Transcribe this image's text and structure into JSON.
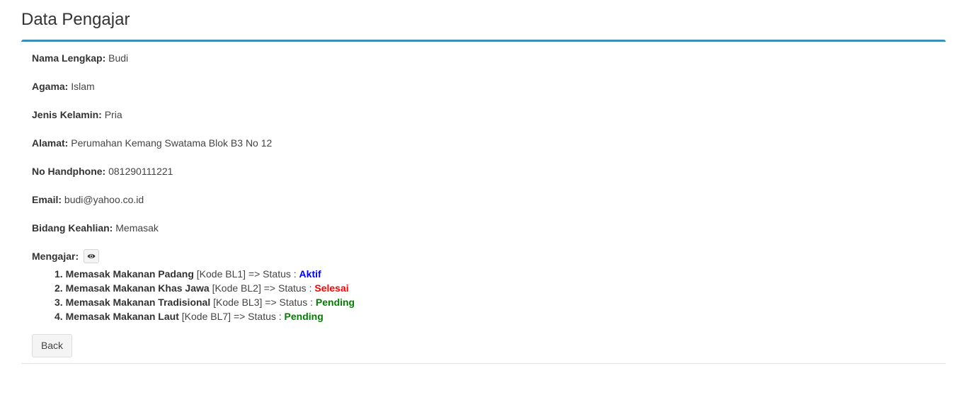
{
  "header": {
    "title": "Data Pengajar"
  },
  "fields": [
    {
      "label": "Nama Lengkap:",
      "value": "Budi"
    },
    {
      "label": "Agama:",
      "value": "Islam"
    },
    {
      "label": "Jenis Kelamin:",
      "value": "Pria"
    },
    {
      "label": "Alamat:",
      "value": "Perumahan Kemang Swatama Blok B3 No 12"
    },
    {
      "label": "No Handphone:",
      "value": "081290111221"
    },
    {
      "label": "Email:",
      "value": "budi@yahoo.co.id"
    },
    {
      "label": "Bidang Keahlian:",
      "value": "Memasak"
    }
  ],
  "teaching": {
    "label": "Mengajar:",
    "toggle_icon": "eye-icon",
    "items": [
      {
        "num": "1.",
        "course": "Memasak Makanan Padang",
        "code": "[Kode BL1]",
        "arrow": "=> Status :",
        "status": "Aktif",
        "status_color": "#0000ff"
      },
      {
        "num": "2.",
        "course": "Memasak Makanan Khas Jawa",
        "code": "[Kode BL2]",
        "arrow": "=> Status :",
        "status": "Selesai",
        "status_color": "#ff0000"
      },
      {
        "num": "3.",
        "course": "Memasak Makanan Tradisional",
        "code": "[Kode BL3]",
        "arrow": "=> Status :",
        "status": "Pending",
        "status_color": "#008000"
      },
      {
        "num": "4.",
        "course": "Memasak Makanan Laut",
        "code": "[Kode BL7]",
        "arrow": "=> Status :",
        "status": "Pending",
        "status_color": "#008000"
      }
    ]
  },
  "actions": {
    "back_label": "Back"
  },
  "colors": {
    "accent": "#3c8dbc"
  }
}
